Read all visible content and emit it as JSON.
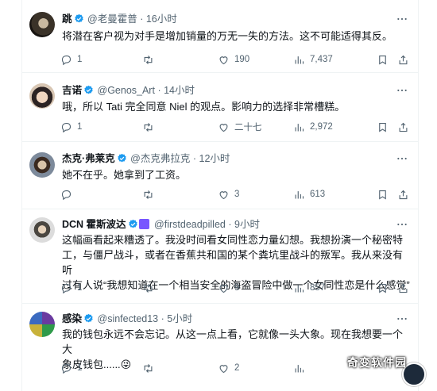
{
  "tweets": [
    {
      "name": "跳",
      "handle": "@老曼霍普",
      "time": "16小时",
      "text": "将潜在客户视为对手是增加销量的万无一失的方法。这不可能适得其反。",
      "replies": "1",
      "retweets": "",
      "likes": "190",
      "views": "7,437"
    },
    {
      "name": "吉诺",
      "handle": "@Genos_Art",
      "time": "14小时",
      "text": "哦，所以 Tati 完全同意 Niel 的观点。影响力的选择非常槽糕。",
      "replies": "1",
      "retweets": "",
      "likes": "二十七",
      "views": "2,972"
    },
    {
      "name": "杰克·弗莱克",
      "handle": "@杰克弗拉克",
      "time": "12小时",
      "text": "她不在乎。她拿到了工资。",
      "replies": "",
      "retweets": "",
      "likes": "3",
      "views": "613"
    },
    {
      "name": "DCN 霍斯波达",
      "handle": "@firstdeadpilled",
      "time": "9小时",
      "text_lines": [
        "这幅画看起来糟透了。我没时间看女同性恋力量幻想。我想扮演一个秘密特",
        "工，与僵尸战斗，或者在香蕉共和国的某个粪坑里战斗的叛军。我从来没有听",
        "过有人说“我想知道在一个相当安全的海盗冒险中做一个女同性恋是什么感觉”"
      ],
      "replies": "1",
      "retweets": "",
      "likes": "9",
      "views": "857"
    },
    {
      "name": "感染",
      "handle": "@sinfected13",
      "time": "5小时",
      "text_lines": [
        "我的钱包永远不会忘记。从这一点上看，它就像一头大象。现在我想要一个大",
        "象皮钱包......😜"
      ],
      "replies": "1",
      "retweets": "",
      "likes": "2",
      "views": ""
    }
  ],
  "sep": "·",
  "watermark": "奇变软件园",
  "colors": {
    "verified": "#1d9bf0",
    "secondary": "#536471",
    "text": "#0f1419"
  },
  "icons": [
    "reply-icon",
    "retweet-icon",
    "like-icon",
    "views-icon",
    "bookmark-icon",
    "share-icon",
    "more-icon",
    "verified-icon"
  ]
}
